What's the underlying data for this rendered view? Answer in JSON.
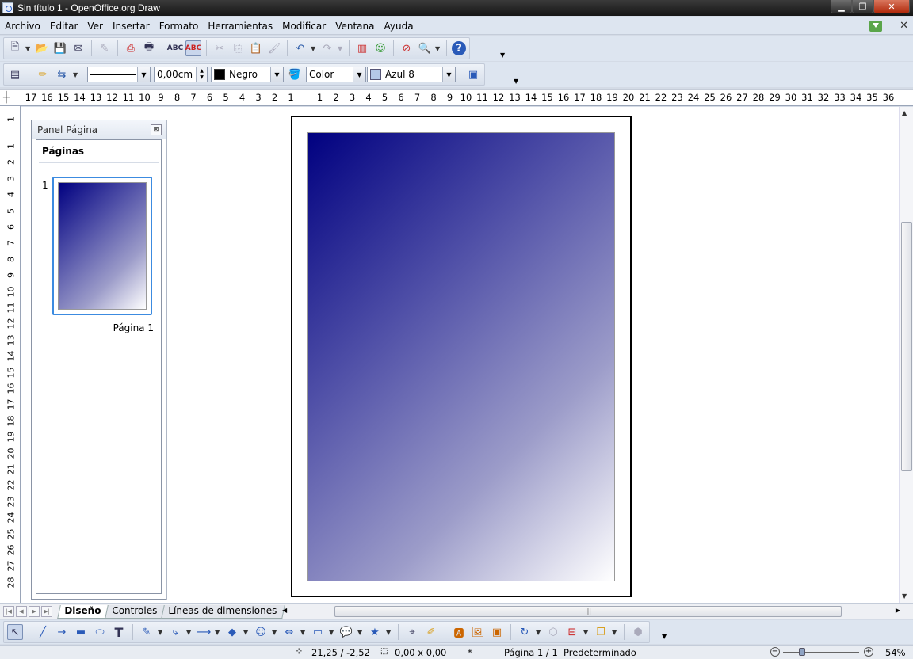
{
  "window": {
    "title": "Sin título 1 - OpenOffice.org Draw"
  },
  "menu": [
    {
      "label": "Archivo"
    },
    {
      "label": "Editar"
    },
    {
      "label": "Ver"
    },
    {
      "label": "Insertar"
    },
    {
      "label": "Formato"
    },
    {
      "label": "Herramientas"
    },
    {
      "label": "Modificar"
    },
    {
      "label": "Ventana"
    },
    {
      "label": "Ayuda"
    }
  ],
  "line_toolbar": {
    "line_width": "0,00cm",
    "line_color": "Negro",
    "line_color_hex": "#000000",
    "area_style": "Color",
    "area_fill": "Azul 8",
    "area_fill_hex": "#b4c7e7"
  },
  "ruler": {
    "horizontal": [
      "17",
      "16",
      "15",
      "14",
      "13",
      "12",
      "11",
      "10",
      "9",
      "8",
      "7",
      "6",
      "5",
      "4",
      "3",
      "2",
      "1",
      "1",
      "2",
      "3",
      "4",
      "5",
      "6",
      "7",
      "8",
      "9",
      "10",
      "11",
      "12",
      "13",
      "14",
      "15",
      "16",
      "17",
      "18",
      "19",
      "20",
      "21",
      "22",
      "23",
      "24",
      "25",
      "26",
      "27",
      "28",
      "29",
      "30",
      "31",
      "32",
      "33",
      "34",
      "35",
      "36"
    ],
    "vertical": [
      "1",
      "1",
      "2",
      "3",
      "4",
      "5",
      "6",
      "7",
      "8",
      "9",
      "10",
      "11",
      "12",
      "13",
      "14",
      "15",
      "16",
      "17",
      "18",
      "19",
      "20",
      "21",
      "22",
      "23",
      "24",
      "25",
      "26",
      "27",
      "28"
    ]
  },
  "panel": {
    "title": "Panel Página",
    "section": "Páginas",
    "slide_number": "1",
    "slide_label": "Página 1"
  },
  "page": {
    "gradient_start": "#000080",
    "gradient_end": "#ffffff"
  },
  "tabs": [
    {
      "label": "Diseño",
      "active": true
    },
    {
      "label": "Controles",
      "active": false
    },
    {
      "label": "Líneas de dimensiones",
      "active": false
    }
  ],
  "status": {
    "position": "21,25 / -2,52",
    "size": "0,00 x 0,00",
    "modified": "*",
    "page": "Página 1 / 1",
    "style": "Predeterminado",
    "zoom_minus": "−",
    "zoom_plus": "+",
    "zoom": "54%"
  }
}
